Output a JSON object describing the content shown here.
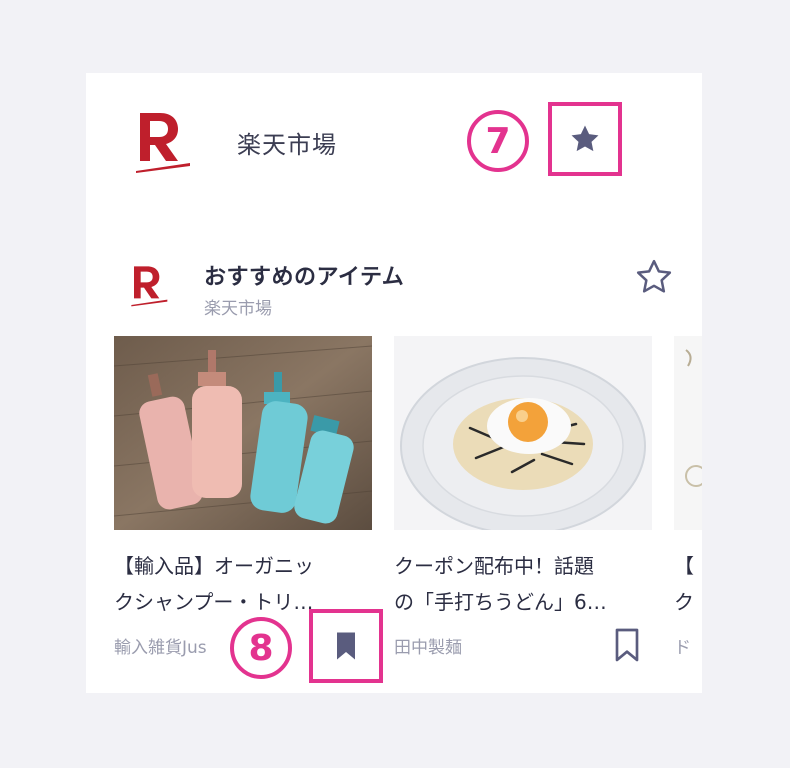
{
  "header": {
    "brand_name": "楽天市場",
    "annotation_7": "7",
    "favorite_icon": "star-filled-icon"
  },
  "section": {
    "title": "おすすめのアイテム",
    "subtitle": "楽天市場",
    "star_icon": "star-outline-icon"
  },
  "products": [
    {
      "name_line1": "【輸入品】オーガニッ",
      "name_line2": "クシャンプー・トリ…",
      "shop": "輸入雑貨Jus",
      "image": "shampoo-bottles"
    },
    {
      "name_line1": "クーポン配布中！話題",
      "name_line2": "の「手打ちうどん」6…",
      "shop": "田中製麺",
      "image": "udon-egg-bowl"
    },
    {
      "name_line1": "【",
      "name_line2": "ク",
      "shop": "ド",
      "image": "jewelry"
    }
  ],
  "annotations": {
    "num_8": "8"
  },
  "colors": {
    "rakuten_red": "#bf1f2c",
    "annotation_pink": "#e3338f",
    "icon_purple": "#5a5c7e",
    "text_dark": "#2b2d42",
    "text_muted": "#9a9cae"
  }
}
